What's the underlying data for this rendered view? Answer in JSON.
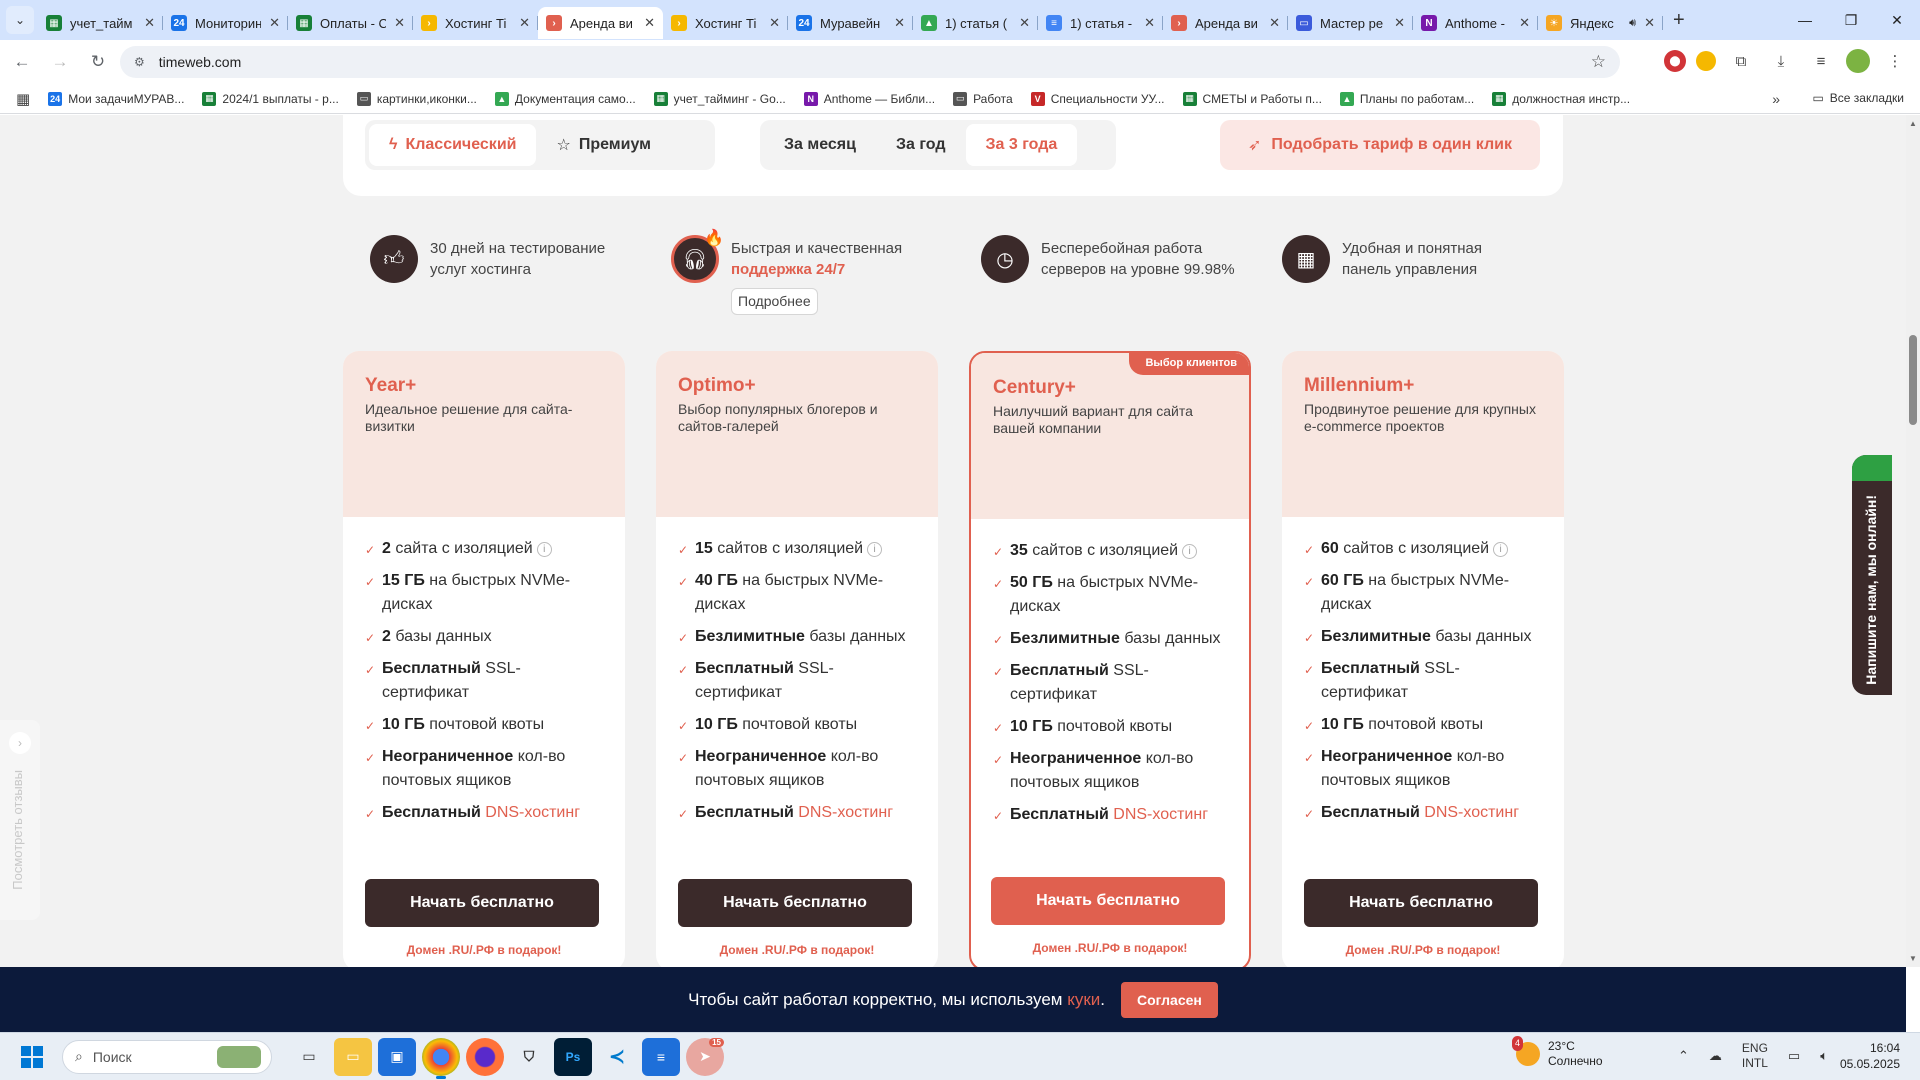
{
  "browser": {
    "tabs": [
      {
        "title": "учет_тайм",
        "icon": "sheets-icon",
        "color": "#188038",
        "glyph": "▦"
      },
      {
        "title": "Мониторин",
        "icon": "bitrix24-icon",
        "color": "#1a73e8",
        "glyph": "24"
      },
      {
        "title": "Оплаты - С",
        "icon": "sheets-icon",
        "color": "#188038",
        "glyph": "▦"
      },
      {
        "title": "Хостинг Ti",
        "icon": "timeweb-icon",
        "color": "#f5b800",
        "glyph": "›"
      },
      {
        "title": "Аренда ви",
        "icon": "timeweb-red-icon",
        "color": "#e0604f",
        "glyph": "›",
        "active": true
      },
      {
        "title": "Хостинг Ti",
        "icon": "timeweb-icon",
        "color": "#f5b800",
        "glyph": "›"
      },
      {
        "title": "Муравейн",
        "icon": "bitrix24-icon",
        "color": "#1a73e8",
        "glyph": "24"
      },
      {
        "title": "1) статья (",
        "icon": "drive-icon",
        "color": "#34a853",
        "glyph": "▲"
      },
      {
        "title": "1) статья -",
        "icon": "docs-icon",
        "color": "#4285f4",
        "glyph": "≡"
      },
      {
        "title": "Аренда ви",
        "icon": "timeweb-red-icon",
        "color": "#e0604f",
        "glyph": "›"
      },
      {
        "title": "Мастер ре",
        "icon": "folder-icon",
        "color": "#3b5bdb",
        "glyph": "▭"
      },
      {
        "title": "Anthome -",
        "icon": "onenote-icon",
        "color": "#7719aa",
        "glyph": "N"
      },
      {
        "title": "Яндекс",
        "icon": "yandex-weather-icon",
        "color": "#f5a623",
        "glyph": "☀",
        "audio": true
      }
    ],
    "url": "timeweb.com",
    "bookmarks": [
      {
        "label": "Мои задачиМУРАВ...",
        "icon": "bitrix24-icon",
        "color": "#1a73e8",
        "glyph": "24"
      },
      {
        "label": "2024/1 выплаты - р...",
        "icon": "sheets-icon",
        "color": "#188038",
        "glyph": "▦"
      },
      {
        "label": "картинки,иконки...",
        "icon": "folder-icon",
        "color": "#555555",
        "glyph": "▭"
      },
      {
        "label": "Документация само...",
        "icon": "drive-icon",
        "color": "#34a853",
        "glyph": "▲"
      },
      {
        "label": "учет_тайминг - Go...",
        "icon": "sheets-icon",
        "color": "#188038",
        "glyph": "▦"
      },
      {
        "label": "Anthome — Библи...",
        "icon": "onenote-icon",
        "color": "#7719aa",
        "glyph": "N"
      },
      {
        "label": "Работа",
        "icon": "folder-icon",
        "color": "#555555",
        "glyph": "▭"
      },
      {
        "label": "Специальности УУ...",
        "icon": "v-logo-icon",
        "color": "#c62828",
        "glyph": "V"
      },
      {
        "label": "СМЕТЫ и Работы п...",
        "icon": "sheets-icon",
        "color": "#188038",
        "glyph": "▦"
      },
      {
        "label": "Планы по работам...",
        "icon": "drive-icon",
        "color": "#34a853",
        "glyph": "▲"
      },
      {
        "label": "должностная инстр...",
        "icon": "sheets-icon",
        "color": "#188038",
        "glyph": "▦"
      }
    ],
    "all_bookmarks": "Все закладки"
  },
  "tariff_bar": {
    "type_options": [
      "Классический",
      "Премиум"
    ],
    "type_selected": "Классический",
    "period_options": [
      "За месяц",
      "За год",
      "За 3 года"
    ],
    "period_selected": "За 3 года",
    "pick_button": "Подобрать тариф в один клик"
  },
  "features": [
    {
      "line1": "30 дней на тестирование",
      "line2": "услуг хостинга",
      "icon": "thumbs-up-icon"
    },
    {
      "line1": "Быстрая и качественная",
      "line2": "поддержка 24/7",
      "icon": "headset-icon",
      "more": "Подробнее"
    },
    {
      "line1": "Бесперебойная работа",
      "line2": "серверов на уровне 99.98%",
      "icon": "clock-icon"
    },
    {
      "line1": "Удобная и понятная",
      "line2": "панель управления",
      "icon": "grid-icon"
    }
  ],
  "plans": [
    {
      "name": "Year+",
      "desc": "Идеальное решение для сайта-визитки",
      "sites": "2",
      "disk": "15 ГБ",
      "db": "2",
      "featured": false
    },
    {
      "name": "Optimo+",
      "desc": "Выбор популярных блогеров и сайтов-галерей",
      "sites": "15",
      "disk": "40 ГБ",
      "db": "Безлимитные",
      "featured": false
    },
    {
      "name": "Century+",
      "desc": "Наилучший вариант для сайта вашей компании",
      "sites": "35",
      "disk": "50 ГБ",
      "db": "Безлимитные",
      "featured": true,
      "badge": "Выбор клиентов"
    },
    {
      "name": "Millennium+",
      "desc": "Продвинутое решение для крупных e-commerce проектов",
      "sites": "60",
      "disk": "60 ГБ",
      "db": "Безлимитные",
      "featured": false
    }
  ],
  "plan_common": {
    "sites_suffix": "сайтов с изоляцией",
    "sites_suffix_2": "сайта с изоляцией",
    "disk_suffix": "на быстрых NVMe-дисках",
    "db_suffix": "базы данных",
    "ssl_bold": "Бесплатный",
    "ssl_rest": "SSL-сертификат",
    "mail_bold": "10 ГБ",
    "mail_rest": "почтовой квоты",
    "boxes_bold": "Неограниченное",
    "boxes_rest": "кол-во почтовых ящиков",
    "dns_bold": "Бесплатный",
    "dns_link": "DNS-хостинг",
    "start_button": "Начать бесплатно",
    "gift": "Домен .RU/.РФ в подарок!"
  },
  "side_tabs": {
    "reviews": "Посмотреть отзывы",
    "chat": "Напишите нам, мы онлайн!"
  },
  "cookie": {
    "text": "Чтобы сайт работал корректно, мы используем",
    "link": "куки",
    "agree": "Согласен"
  },
  "taskbar": {
    "search": "Поиск",
    "weather_temp": "23°C",
    "weather_desc": "Солнечно",
    "weather_badge": "4",
    "telegram_badge": "15",
    "lang1": "ENG",
    "lang2": "INTL",
    "time": "16:04",
    "date": "05.05.2025"
  },
  "colors": {
    "accent": "#e0604f",
    "dark": "#3b2a2a",
    "card_head": "#f8e6e0",
    "cookie_bg": "#0c1a3b"
  }
}
